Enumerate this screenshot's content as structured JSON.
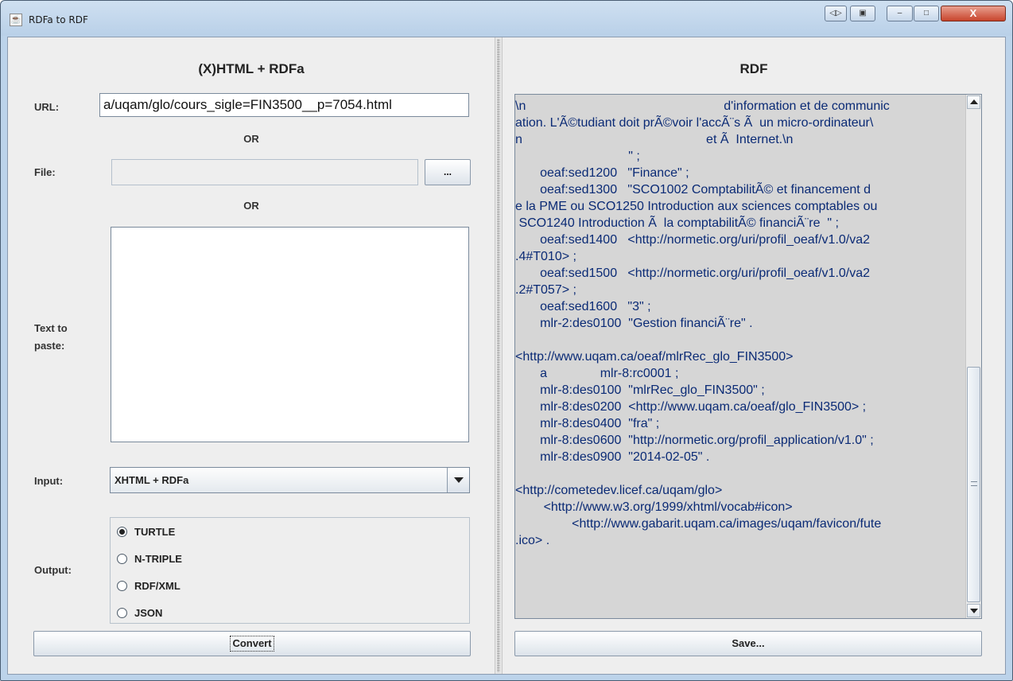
{
  "window": {
    "title": "RDFa to RDF",
    "app_icon": "java-cup-icon",
    "titlebar_buttons": {
      "restore_left": "◁▷",
      "restore_right": "▣",
      "minimize": "–",
      "maximize": "□",
      "close": "X"
    }
  },
  "left": {
    "heading": "(X)HTML + RDFa",
    "url_label": "URL:",
    "url_value": "a/uqam/glo/cours_sigle=FIN3500__p=7054.html",
    "or1": "OR",
    "file_label": "File:",
    "file_value": "",
    "browse_label": "...",
    "or2": "OR",
    "text_label_line1": "Text to",
    "text_label_line2": "paste:",
    "text_value": "",
    "input_label": "Input:",
    "input_selected": "XHTML + RDFa",
    "output_label": "Output:",
    "output_options": [
      {
        "label": "TURTLE",
        "checked": true
      },
      {
        "label": "N-TRIPLE",
        "checked": false
      },
      {
        "label": "RDF/XML",
        "checked": false
      },
      {
        "label": "JSON",
        "checked": false
      }
    ],
    "convert_label": "Convert"
  },
  "right": {
    "heading": "RDF",
    "save_label": "Save...",
    "rdf_lines": [
      "\\n                                                        d'information et de communic",
      "ation. L'Ã©tudiant doit prÃ©voir l'accÃ¨s Ã  un micro-ordinateur\\",
      "n                                                    et Ã  Internet.\\n",
      "                                \" ;",
      "       oeaf:sed1200   \"Finance\" ;",
      "       oeaf:sed1300   \"SCO1002 ComptabilitÃ© et financement d",
      "e la PME ou SCO1250 Introduction aux sciences comptables ou",
      " SCO1240 Introduction Ã  la comptabilitÃ© financiÃ¨re  \" ;",
      "       oeaf:sed1400   <http://normetic.org/uri/profil_oeaf/v1.0/va2",
      ".4#T010> ;",
      "       oeaf:sed1500   <http://normetic.org/uri/profil_oeaf/v1.0/va2",
      ".2#T057> ;",
      "       oeaf:sed1600   \"3\" ;",
      "       mlr-2:des0100  \"Gestion financiÃ¨re\" .",
      "",
      "<http://www.uqam.ca/oeaf/mlrRec_glo_FIN3500>",
      "       a               mlr-8:rc0001 ;",
      "       mlr-8:des0100  \"mlrRec_glo_FIN3500\" ;",
      "       mlr-8:des0200  <http://www.uqam.ca/oeaf/glo_FIN3500> ;",
      "       mlr-8:des0400  \"fra\" ;",
      "       mlr-8:des0600  \"http://normetic.org/profil_application/v1.0\" ;",
      "       mlr-8:des0900  \"2014-02-05\" .",
      "",
      "<http://cometedev.licef.ca/uqam/glo>",
      "        <http://www.w3.org/1999/xhtml/vocab#icon>",
      "                <http://www.gabarit.uqam.ca/images/uqam/favicon/fute",
      ".ico> ."
    ],
    "scroll_position": 0.55
  }
}
